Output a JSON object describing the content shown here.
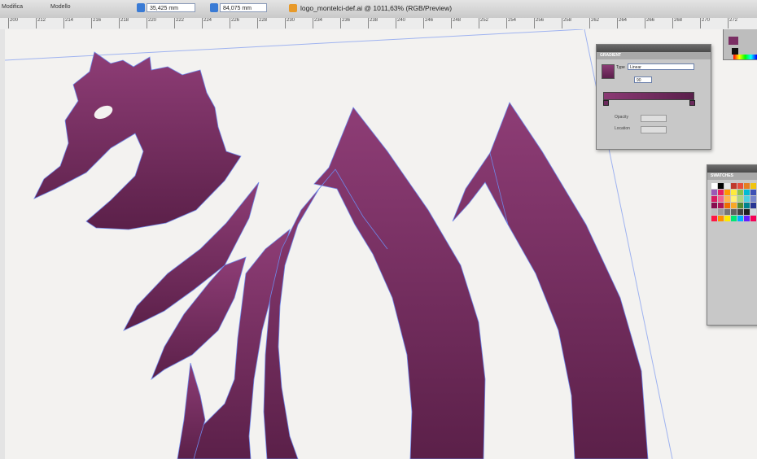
{
  "app": {
    "document_tab": "logo_montelci-def.ai @ 1011,63% (RGB/Preview)"
  },
  "toolbar": {
    "left_label": "Modifica",
    "mid_label": "Modello",
    "w_value": "35,425 mm",
    "h_value": "84,075 mm"
  },
  "ruler": {
    "ticks": [
      "200",
      "212",
      "214",
      "216",
      "218",
      "220",
      "222",
      "224",
      "226",
      "228",
      "230",
      "234",
      "236",
      "238",
      "240",
      "246",
      "248",
      "252",
      "254",
      "256",
      "258",
      "262",
      "264",
      "266",
      "268",
      "270",
      "272"
    ]
  },
  "gradient_panel": {
    "tab_label": "GRADIENT",
    "type_label": "Type",
    "type_value": "Linear",
    "angle_value": "90",
    "opacity_label": "Opacity",
    "location_label": "Location",
    "start_color": "#8b3a74",
    "end_color": "#5a1f4b"
  },
  "swatches_panel": {
    "tab_label": "SWATCHES",
    "colors": [
      "#ffffff",
      "#000000",
      "#e8e8e8",
      "#c0392b",
      "#e74c3c",
      "#e67e22",
      "#f1c40f",
      "#2ecc71",
      "#3498db",
      "#9b59b6",
      "#e91e63",
      "#ff9800",
      "#ffeb3b",
      "#8bc34a",
      "#00bcd4",
      "#3f51b5",
      "#795548",
      "#607d8b",
      "#d81b60",
      "#f06292",
      "#ffb74d",
      "#fff176",
      "#aed581",
      "#4dd0e1",
      "#7986cb",
      "#a1887f",
      "#90a4ae",
      "#880e4f",
      "#ad1457",
      "#ef6c00",
      "#f9a825",
      "#558b2f",
      "#00838f",
      "#283593",
      "#4e342e",
      "#37474f",
      "#bdbdbd",
      "#9e9e9e",
      "#757575",
      "#616161",
      "#424242",
      "#212121",
      "#cfd8dc",
      "#b0bec5",
      "#78909c",
      "#ff1744",
      "#ff9100",
      "#ffea00",
      "#00e676",
      "#00b0ff",
      "#651fff",
      "#f50057",
      "#c6ff00",
      "#1de9b6"
    ]
  },
  "artwork": {
    "fill_top": "#8e3d76",
    "fill_bottom": "#5b2049",
    "path_color": "#6f86e8"
  }
}
